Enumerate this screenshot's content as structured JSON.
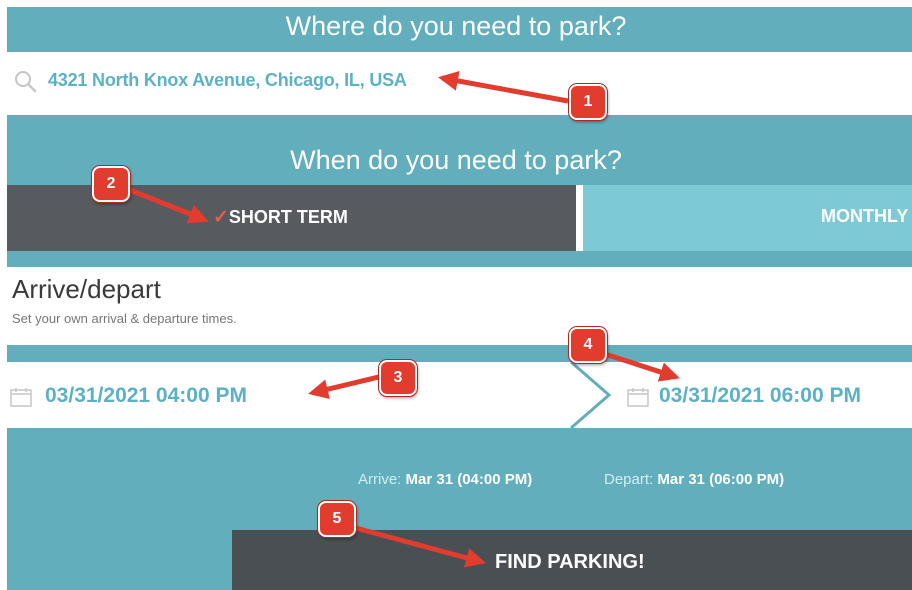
{
  "where": {
    "heading": "Where do you need to park?",
    "search_value": "4321 North Knox Avenue, Chicago, IL, USA",
    "search_icon": "search-icon"
  },
  "when": {
    "heading": "When do you need to park?",
    "tabs": [
      {
        "label": "SHORT TERM",
        "selected": true,
        "check": "✓"
      },
      {
        "label": "MONTHLY",
        "selected": false
      }
    ]
  },
  "arrive_depart": {
    "title": "Arrive/depart",
    "subtitle": "Set your own arrival & departure times."
  },
  "dates": {
    "arrive_value": "03/31/2021 04:00 PM",
    "depart_value": "03/31/2021 06:00 PM",
    "icon": "calendar-icon"
  },
  "summary": {
    "arrive_label": "Arrive:",
    "arrive_value": "Mar 31 (04:00 PM)",
    "depart_label": "Depart:",
    "depart_value": "Mar 31 (06:00 PM)"
  },
  "find_button": {
    "label": "FIND PARKING!"
  },
  "annotations": [
    "1",
    "2",
    "3",
    "4",
    "5"
  ],
  "colors": {
    "teal": "#62aebd",
    "text_teal": "#5bb1c6",
    "selected_tab": "#575a5e",
    "unselected_tab": "#7dcad6",
    "button": "#4a4f54",
    "badge_red": "#e23c2f"
  }
}
